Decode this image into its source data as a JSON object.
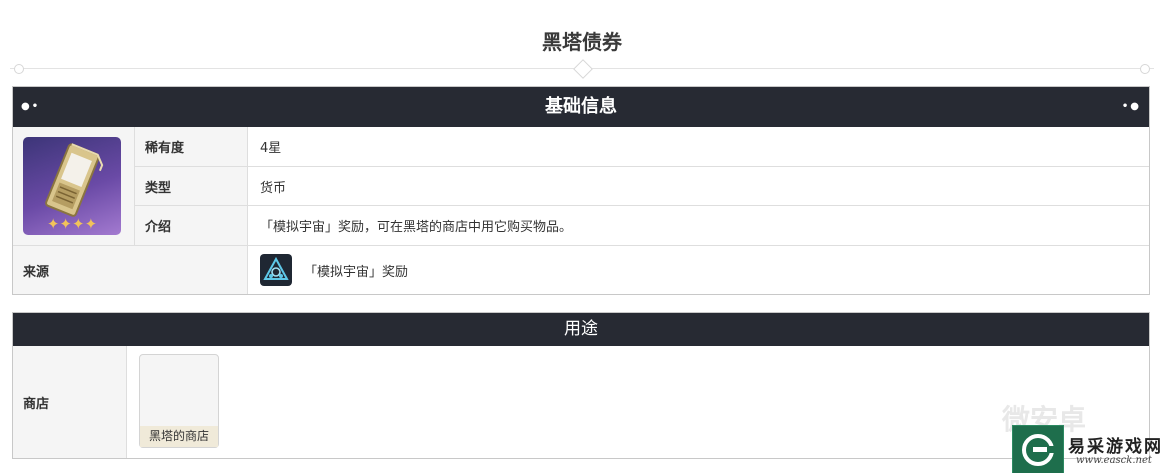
{
  "page": {
    "title": "黑塔债券"
  },
  "info_section": {
    "header": "基础信息",
    "header_decoration_left": "●•",
    "header_decoration_right": "•●",
    "item_stars": "✦✦✦✦",
    "rows": [
      {
        "label": "稀有度",
        "value": "4星"
      },
      {
        "label": "类型",
        "value": "货币"
      },
      {
        "label": "介绍",
        "value": "「模拟宇宙」奖励，可在黑塔的商店中用它购买物品。"
      }
    ],
    "source": {
      "label": "来源",
      "value": "「模拟宇宙」奖励",
      "icon": "simulated-universe-icon"
    }
  },
  "use_section": {
    "header": "用途",
    "rows": [
      {
        "label": "商店",
        "card_caption": "黑塔的商店"
      }
    ]
  },
  "watermark": {
    "ghost_text": "微安卓",
    "site_name": "易采游戏网",
    "site_url": "www.easck.net"
  },
  "colors": {
    "header_bg": "#272a33",
    "label_bg": "#f5f5f5",
    "card_caption_bg": "#f0ead9",
    "star_color": "#f1c35a",
    "item_bg_purple": "#6a4aa6"
  }
}
